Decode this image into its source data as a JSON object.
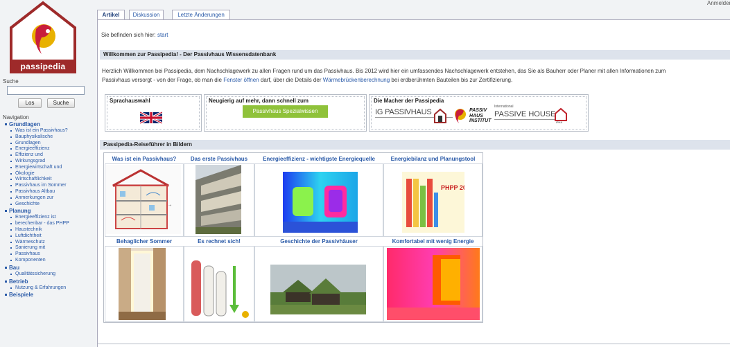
{
  "site": {
    "logo_text": "passipedia"
  },
  "user_link": "Anmelden",
  "search": {
    "heading": "Suche",
    "go_label": "Los",
    "search_label": "Suche",
    "value": ""
  },
  "nav": {
    "heading": "Navigation",
    "sections": [
      {
        "label": "Grundlagen",
        "items": [
          "Was ist ein Passivhaus?",
          "Bauphysikalische",
          "Grundlagen",
          "Energieeffizienz",
          "Effizienz und",
          "Wirkungsgrad",
          "Energiewirtschaft und",
          "Ökologie",
          "Wirtschaftlichkeit",
          "Passivhaus im Sommer",
          "Passivhaus Altbau",
          "Anmerkungen zur",
          "Geschichte"
        ]
      },
      {
        "label": "Planung",
        "items": [
          "Energieeffizienz ist",
          "berechenbar - das PHPP",
          "Haustechnik",
          "Luftdichtheit",
          "Wärmeschutz",
          "Sanierung mit",
          "Passivhaus",
          "Komponenten"
        ]
      },
      {
        "label": "Bau",
        "items": [
          "Qualitätssicherung"
        ]
      },
      {
        "label": "Betrieb",
        "items": [
          "Nutzung & Erfahrungen"
        ]
      },
      {
        "label": "Beispiele",
        "items": []
      }
    ]
  },
  "tabs": [
    {
      "label": "Artikel",
      "active": true
    },
    {
      "label": "Diskussion",
      "active": false
    },
    {
      "label": "Letzte Änderungen",
      "active": false
    }
  ],
  "breadcrumb": {
    "prefix": "Sie befinden sich hier: ",
    "link": "start"
  },
  "welcome": {
    "title": "Willkommen zur Passipedia! - Der Passivhaus Wissensdatenbank",
    "text_1": "Herzlich Willkommen bei Passipedia, dem Nachschlagewerk zu allen Fragen rund um das Passivhaus. Bis 2012 wird hier ein umfassendes Nachschlagewerk entstehen, das Sie als Bauherr oder Planer mit allen Informationen zum",
    "text_2a": "Passivhaus versorgt - von der Frage, ob man die ",
    "link_1": "Fenster öffnen",
    "text_2b": " darf, über die Details der ",
    "link_2": "Wärmebrückenberechnung",
    "text_2c": " bei erdberühmten Bauteilen bis zur Zertifizierung."
  },
  "boxes": {
    "language": {
      "title": "Sprachauswahl"
    },
    "curious": {
      "title": "Neugierig auf mehr, dann schnell zum",
      "button": "Passivhaus Spezialwissen"
    },
    "makers": {
      "title": "Die Macher der Passipedia",
      "logo_igp": "IG PASSIVHAUS",
      "logo_phi": "PASSIV HAUS INSTITUT",
      "logo_ipha": "PASSIVE HOUSE",
      "logo_ipha_small": "International",
      "logo_ipha_tag": "iPHA"
    }
  },
  "gallery": {
    "title": "Passipedia-Reiseführer in Bildern",
    "cells": [
      {
        "label": "Was ist ein Passivhaus?"
      },
      {
        "label": "Das erste Passivhaus"
      },
      {
        "label": "Energieeffizienz - wichtigste Energiequelle"
      },
      {
        "label": "Energiebilanz und Planungstool",
        "badge": "PHPP 2007"
      },
      {
        "label": "Behaglicher Sommer"
      },
      {
        "label": "Es rechnet sich!"
      },
      {
        "label": "Geschichte der Passivhäuser"
      },
      {
        "label": "Komfortabel mit wenig Energie"
      }
    ]
  },
  "colors": {
    "brand_red": "#9e2a2a",
    "link": "#2a5aa8",
    "bar": "#dde3ec",
    "green_button": "#8fc23a"
  }
}
